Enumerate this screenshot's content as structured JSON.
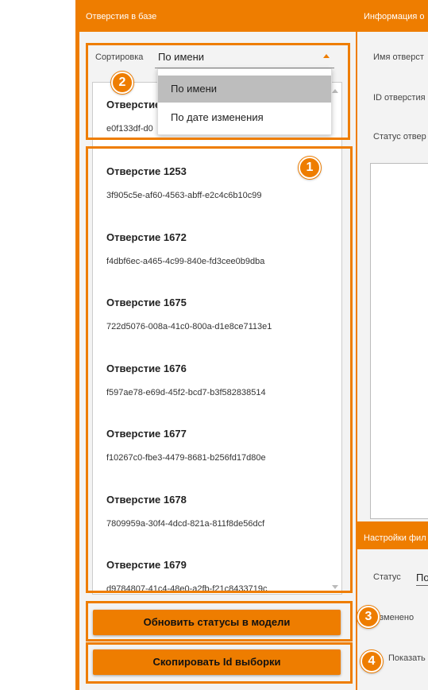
{
  "left_panel": {
    "header": "Отверстия в базе",
    "sort_label": "Сортировка",
    "sort_value": "По имени",
    "dropdown_options": [
      "По имени",
      "По дате изменения"
    ],
    "list_items": [
      {
        "title": "Отверстие",
        "id": "e0f133df-d0"
      },
      {
        "title": "Отверстие 1253",
        "id": "3f905c5e-af60-4563-abff-e2c4c6b10c99"
      },
      {
        "title": "Отверстие 1672",
        "id": "f4dbf6ec-a465-4c99-840e-fd3cee0b9dba"
      },
      {
        "title": "Отверстие 1675",
        "id": "722d5076-008a-41c0-800a-d1e8ce7113e1"
      },
      {
        "title": "Отверстие 1676",
        "id": "f597ae78-e69d-45f2-bcd7-b3f582838514"
      },
      {
        "title": "Отверстие 1677",
        "id": "f10267c0-fbe3-4479-8681-b256fd17d80e"
      },
      {
        "title": "Отверстие 1678",
        "id": "7809959a-30f4-4dcd-821a-811f8de56dcf"
      },
      {
        "title": "Отверстие 1679",
        "id": "d9784807-41c4-48e0-a2fb-f21c8433719c"
      }
    ],
    "update_button": "Обновить статусы в модели",
    "copy_button": "Скопировать Id выборки"
  },
  "info_panel": {
    "header": "Информация о",
    "name_label": "Имя отверст",
    "id_label": "ID отверстия",
    "status_label": "Статус отвер"
  },
  "filter_panel": {
    "header": "Настройки фил",
    "status_label": "Статус",
    "status_value": "По",
    "changed_label": "зменено",
    "show_label": "Показать"
  },
  "badges": [
    "1",
    "2",
    "3",
    "4"
  ],
  "colors": {
    "accent": "#ee7d00",
    "selected": "#bdbdbd"
  }
}
